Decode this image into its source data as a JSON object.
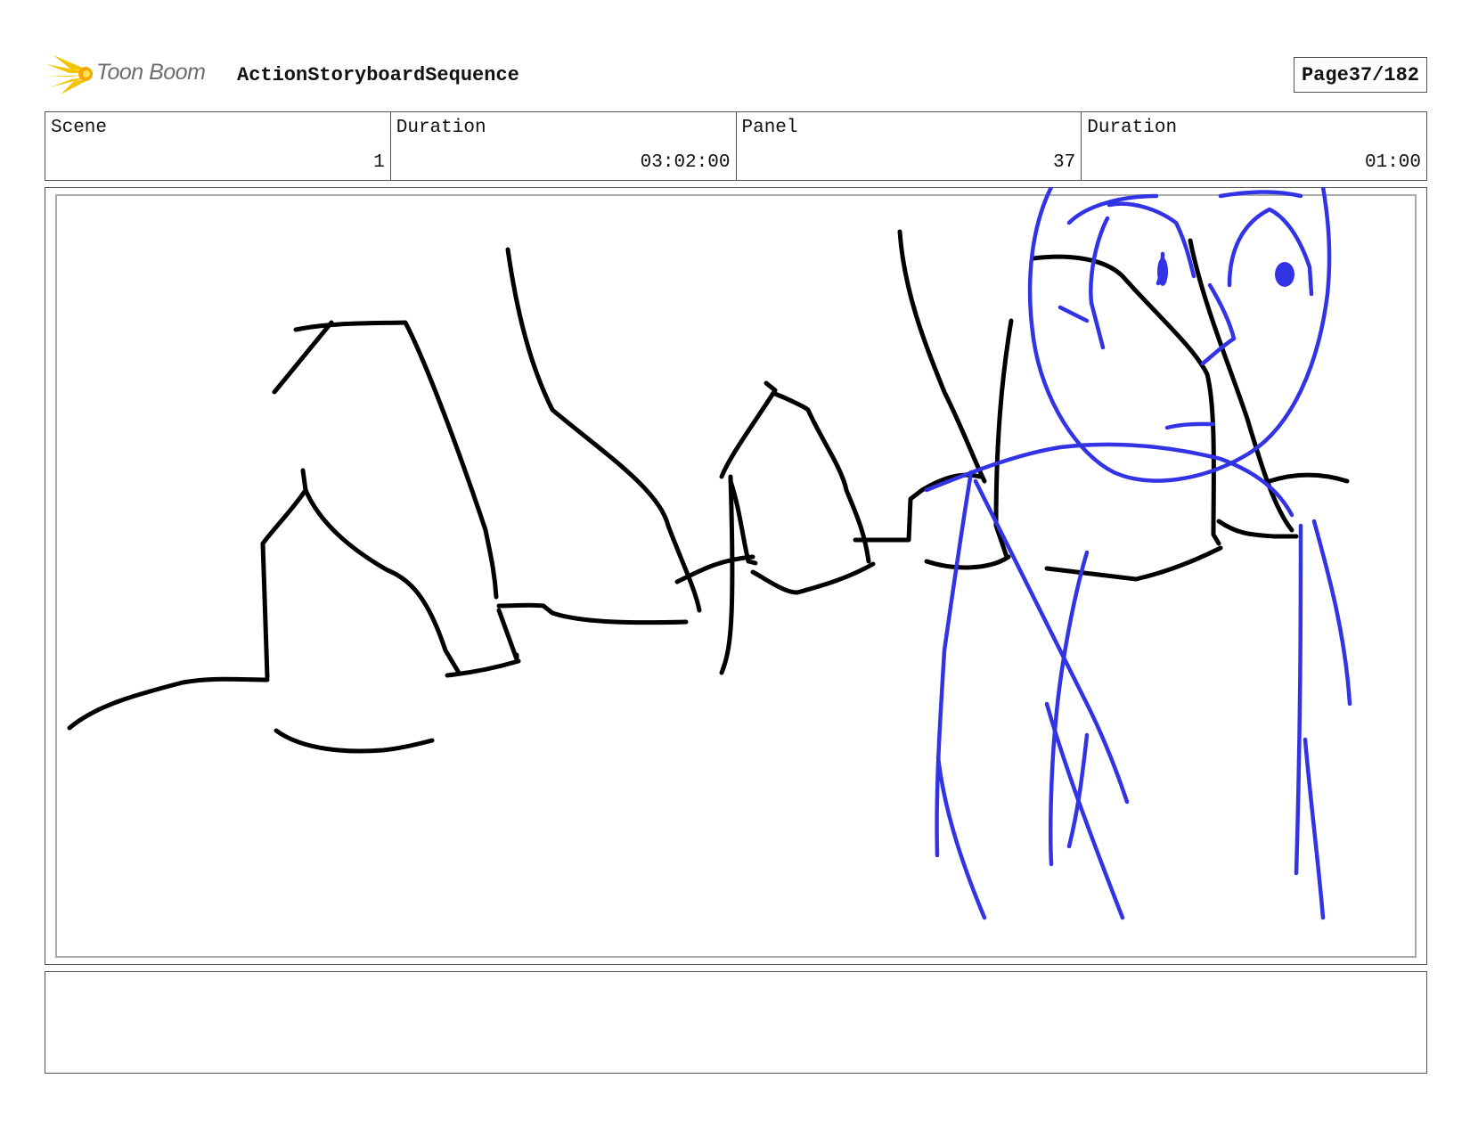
{
  "header": {
    "logo_text": "Toon Boom",
    "project_title": "ActionStoryboardSequence",
    "page_label": "Page",
    "page_number": "37/182"
  },
  "info": {
    "scene_label": "Scene",
    "scene_value": "1",
    "scene_duration_label": "Duration",
    "scene_duration_value": "03:02:00",
    "panel_label": "Panel",
    "panel_value": "37",
    "panel_duration_label": "Duration",
    "panel_duration_value": "01:00"
  },
  "notes": {
    "text": ""
  },
  "colors": {
    "sketch_black": "#000000",
    "sketch_blue": "#3333e6",
    "logo_yellow": "#f5c400"
  }
}
